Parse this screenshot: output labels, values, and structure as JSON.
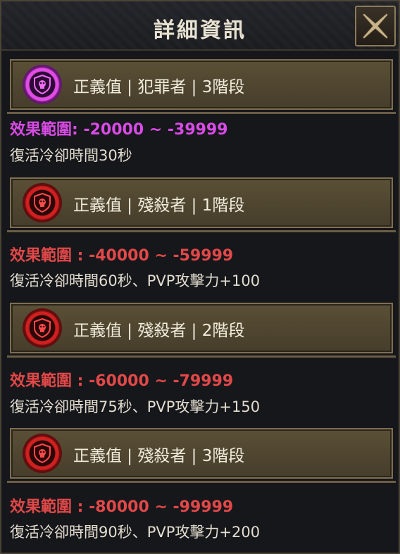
{
  "window": {
    "title": "詳細資訊"
  },
  "colors": {
    "purple": "#d94be6",
    "red": "#e24848",
    "text": "#e3ddcf"
  },
  "tiers": [
    {
      "icon": "skull-shield-icon",
      "header": "正義值 | 犯罪者 | 3階段",
      "effect": "效果範圍: -20000 ~ -39999",
      "description": "復活冷卻時間30秒"
    },
    {
      "icon": "skull-shield-icon",
      "header": "正義值 | 殘殺者 | 1階段",
      "effect": "效果範圍 : -40000 ~ -59999",
      "description": "復活冷卻時間60秒、PVP攻擊力+100"
    },
    {
      "icon": "skull-shield-icon",
      "header": "正義值 | 殘殺者 | 2階段",
      "effect": "效果範圍 : -60000 ~ -79999",
      "description": "復活冷卻時間75秒、PVP攻擊力+150"
    },
    {
      "icon": "skull-shield-icon",
      "header": "正義值 | 殘殺者 | 3階段",
      "effect": "效果範圍 : -80000 ~ -99999",
      "description": "復活冷卻時間90秒、PVP攻擊力+200"
    }
  ]
}
